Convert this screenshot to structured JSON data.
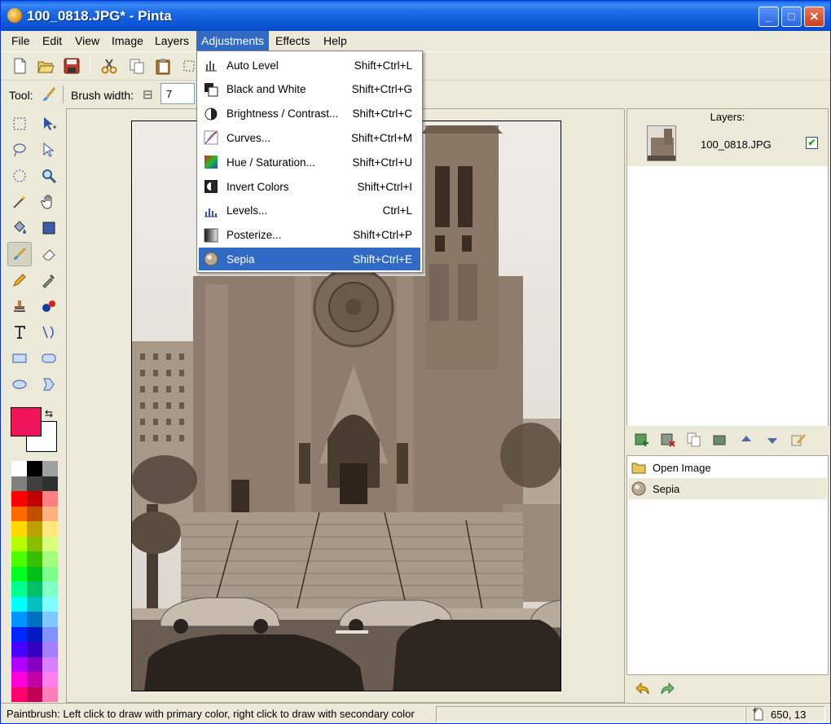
{
  "window": {
    "title": "100_0818.JPG* - Pinta",
    "controls": {
      "minimize": "_",
      "maximize": "□",
      "close": "✕"
    }
  },
  "menubar": {
    "items": [
      "File",
      "Edit",
      "View",
      "Image",
      "Layers",
      "Adjustments",
      "Effects",
      "Help"
    ],
    "active": "Adjustments"
  },
  "toolbar": {
    "icons": [
      "new-icon",
      "open-icon",
      "save-icon",
      "cut-icon",
      "copy-icon",
      "paste-icon",
      "crop-icon"
    ]
  },
  "options": {
    "tool_label": "Tool:",
    "brush_width_label": "Brush width:",
    "brush_width_value": "7",
    "brush_width_minus": "⊟"
  },
  "adjustments_menu": [
    {
      "label": "Auto Level",
      "shortcut": "Shift+Ctrl+L",
      "icon": "auto-level-icon"
    },
    {
      "label": "Black and White",
      "shortcut": "Shift+Ctrl+G",
      "icon": "black-white-icon"
    },
    {
      "label": "Brightness / Contrast...",
      "shortcut": "Shift+Ctrl+C",
      "icon": "brightness-contrast-icon"
    },
    {
      "label": "Curves...",
      "shortcut": "Shift+Ctrl+M",
      "icon": "curves-icon"
    },
    {
      "label": "Hue / Saturation...",
      "shortcut": "Shift+Ctrl+U",
      "icon": "hue-saturation-icon"
    },
    {
      "label": "Invert Colors",
      "shortcut": "Shift+Ctrl+I",
      "icon": "invert-colors-icon"
    },
    {
      "label": "Levels...",
      "shortcut": "Ctrl+L",
      "icon": "levels-icon"
    },
    {
      "label": "Posterize...",
      "shortcut": "Shift+Ctrl+P",
      "icon": "posterize-icon"
    },
    {
      "label": "Sepia",
      "shortcut": "Shift+Ctrl+E",
      "icon": "sepia-icon",
      "selected": true
    }
  ],
  "layers": {
    "title": "Layers:",
    "items": [
      {
        "name": "100_0818.JPG",
        "visible": true
      }
    ],
    "visible_check": "✔"
  },
  "history": {
    "items": [
      {
        "label": "Open Image",
        "icon": "folder-icon"
      },
      {
        "label": "Sepia",
        "icon": "sepia-icon",
        "selected": true
      }
    ]
  },
  "colors": {
    "primary": "#f0145a",
    "secondary": "#ffffff",
    "accent": "#316ac5",
    "palette": [
      "#ffffff",
      "#000000",
      "#a0a0a0",
      "#808080",
      "#404040",
      "#303030",
      "#ff0000",
      "#c00000",
      "#ff8080",
      "#ff6a00",
      "#c05000",
      "#ffb27f",
      "#ffd800",
      "#c0a000",
      "#ffe97f",
      "#b6ff00",
      "#88c000",
      "#daff7f",
      "#4cff00",
      "#38c000",
      "#a5ff7f",
      "#00ff21",
      "#00c018",
      "#7fff8e",
      "#00ff90",
      "#00c06c",
      "#7fffc5",
      "#00ffff",
      "#00c0c0",
      "#7fffff",
      "#0094ff",
      "#0070c0",
      "#7fc9ff",
      "#0026ff",
      "#001cc0",
      "#7f92ff",
      "#4800ff",
      "#3600c0",
      "#a17fff",
      "#b200ff",
      "#8600c0",
      "#d67fff",
      "#ff00dc",
      "#c000a5",
      "#ff7fed",
      "#ff006e",
      "#c00052",
      "#ff7fb6"
    ]
  },
  "statusbar": {
    "text": "Paintbrush: Left click to draw with primary color, right click to draw with secondary color",
    "coords": "650, 13"
  }
}
